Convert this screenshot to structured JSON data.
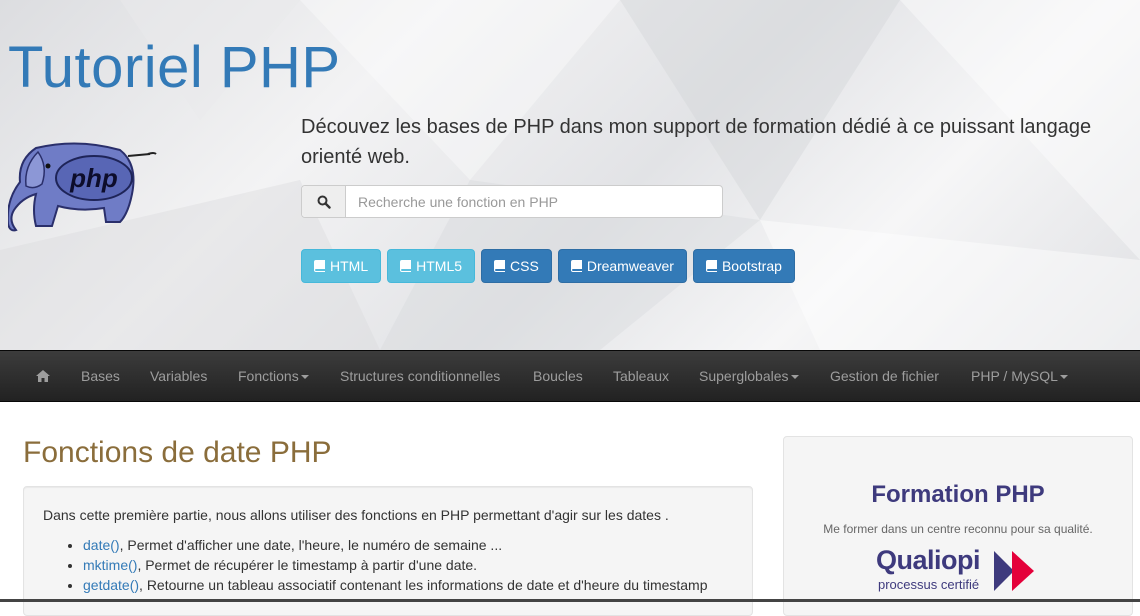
{
  "header": {
    "title": "Tutoriel PHP",
    "tagline": "Découvez les bases de PHP dans mon support de formation dédié à ce puissant langage orienté web.",
    "logo_text": "php",
    "search": {
      "placeholder": "Recherche une fonction en PHP",
      "value": ""
    },
    "buttons": [
      {
        "label": "HTML",
        "style": "info",
        "icon": "book-icon"
      },
      {
        "label": "HTML5",
        "style": "info",
        "icon": "book-icon"
      },
      {
        "label": "CSS",
        "style": "primary",
        "icon": "book-icon"
      },
      {
        "label": "Dreamweaver",
        "style": "primary",
        "icon": "book-icon"
      },
      {
        "label": "Bootstrap",
        "style": "primary",
        "icon": "book-icon"
      }
    ]
  },
  "navbar": {
    "home_icon": "home-icon",
    "items": [
      {
        "label": "Bases",
        "dropdown": false
      },
      {
        "label": "Variables",
        "dropdown": false
      },
      {
        "label": "Fonctions",
        "dropdown": true
      },
      {
        "label": "Structures conditionnelles",
        "dropdown": false
      },
      {
        "label": "Boucles",
        "dropdown": false
      },
      {
        "label": "Tableaux",
        "dropdown": false
      },
      {
        "label": "Superglobales",
        "dropdown": true
      },
      {
        "label": "Gestion de fichier",
        "dropdown": false
      },
      {
        "label": "PHP / MySQL",
        "dropdown": true
      }
    ]
  },
  "main": {
    "heading": "Fonctions de date PHP",
    "intro": "Dans cette première partie, nous allons utiliser des fonctions en PHP permettant d'agir sur les dates .",
    "functions": [
      {
        "name": "date()",
        "desc": ", Permet d'afficher une date, l'heure, le numéro de semaine ..."
      },
      {
        "name": "mktime()",
        "desc": ", Permet de récupérer le timestamp à partir d'une date."
      },
      {
        "name": "getdate()",
        "desc": ", Retourne un tableau associatif contenant les informations de date et d'heure du timestamp"
      }
    ]
  },
  "sidebar": {
    "title": "Formation PHP",
    "subtitle": "Me former dans un centre reconnu pour sa qualité.",
    "qualiopi": {
      "word": "Qualiopi",
      "certified": "processus certifié"
    }
  },
  "colors": {
    "title": "#337ab7",
    "heading": "#8a6d3b",
    "link": "#337ab7",
    "btn_info": "#5bc0de",
    "btn_primary": "#337ab7",
    "navbar": "#222222",
    "qualiopi_blue": "#3e3a7d",
    "qualiopi_red": "#e4003a"
  }
}
